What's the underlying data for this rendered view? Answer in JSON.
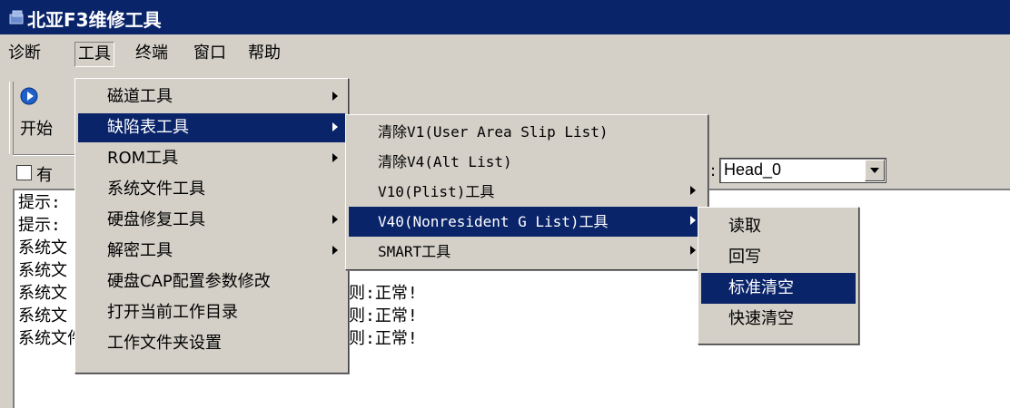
{
  "window": {
    "title": "北亚F3维修工具",
    "icon": "app-icon"
  },
  "menubar": [
    "诊断",
    "工具",
    "终端",
    "窗口",
    "帮助"
  ],
  "toolbar": {
    "start_label": "开始"
  },
  "checkbox": {
    "label": "有"
  },
  "head_select": {
    "value": "Head_0"
  },
  "log_lines": [
    "提示:",
    "提示:",
    "系统文",
    "系统文",
    "系统文",
    "系统文",
    "系统文件:28 数据模块COPY0检测:正常!"
  ],
  "log_tails": [
    "",
    "",
    "",
    "则:正常!",
    "则:正常!",
    "则:正常!",
    ""
  ],
  "tools_menu": [
    {
      "label": "磁道工具",
      "submenu": true
    },
    {
      "label": "缺陷表工具",
      "submenu": true,
      "highlighted": true
    },
    {
      "label": "ROM工具",
      "submenu": true
    },
    {
      "label": "系统文件工具",
      "submenu": false
    },
    {
      "label": "硬盘修复工具",
      "submenu": true
    },
    {
      "label": "解密工具",
      "submenu": true
    },
    {
      "label": "硬盘CAP配置参数修改",
      "submenu": false
    },
    {
      "label": "打开当前工作目录",
      "submenu": false
    },
    {
      "label": "工作文件夹设置",
      "submenu": false
    }
  ],
  "defect_menu": [
    {
      "label": "清除V1(User Area Slip List)",
      "submenu": false
    },
    {
      "label": "清除V4(Alt List)",
      "submenu": false
    },
    {
      "label": "V10(Plist)工具",
      "submenu": true
    },
    {
      "label": "V40(Nonresident G List)工具",
      "submenu": true,
      "highlighted": true
    },
    {
      "label": "SMART工具",
      "submenu": true
    }
  ],
  "v40_menu": [
    {
      "label": "读取"
    },
    {
      "label": "回写"
    },
    {
      "label": "标准清空",
      "highlighted": true
    },
    {
      "label": "快速清空"
    }
  ],
  "colors": {
    "titlebar": "#0a246a",
    "highlight": "#0a246a",
    "face": "#d4d0c8"
  }
}
